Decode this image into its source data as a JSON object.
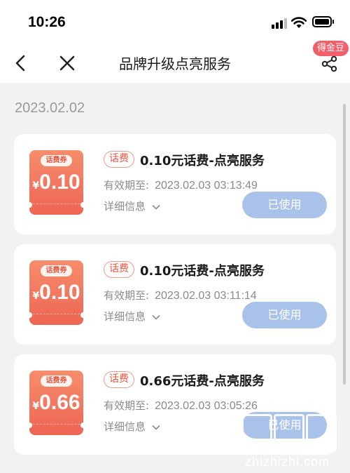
{
  "status_bar": {
    "time": "10:26"
  },
  "nav": {
    "title": "品牌升级点亮服务",
    "badge": "得金豆"
  },
  "section": {
    "date": "2023.02.02"
  },
  "coupons": [
    {
      "coupon_tag": "话费券",
      "currency": "¥",
      "value": "0.10",
      "tag": "话费",
      "title": "0.10元话费-点亮服务",
      "expiry_label": "有效期至:",
      "expiry": "2023.02.03 03:13:49",
      "details_label": "详细信息",
      "status_button": "已使用"
    },
    {
      "coupon_tag": "话费券",
      "currency": "¥",
      "value": "0.10",
      "tag": "话费",
      "title": "0.10元话费-点亮服务",
      "expiry_label": "有效期至:",
      "expiry": "2023.02.03 03:11:14",
      "details_label": "详细信息",
      "status_button": "已使用"
    },
    {
      "coupon_tag": "话费券",
      "currency": "¥",
      "value": "0.66",
      "tag": "话费",
      "title": "0.66元话费-点亮服务",
      "expiry_label": "有效期至:",
      "expiry": "2023.02.03 03:05:26",
      "details_label": "详细信息",
      "status_button": "已使用"
    }
  ],
  "watermark": {
    "text": "zhizhizhi.com"
  },
  "colors": {
    "accent_red": "#ee6553",
    "used_button": "#a9c2e9",
    "badge": "#f1606a",
    "background": "#f2f2f2"
  },
  "icons": [
    "signal-icon",
    "wifi-icon",
    "battery-icon",
    "back-arrow-icon",
    "close-icon",
    "share-icon",
    "chevron-down-icon"
  ]
}
